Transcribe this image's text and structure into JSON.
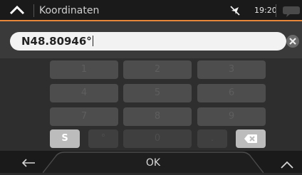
{
  "header": {
    "title": "Koordinaten",
    "time": "19:20"
  },
  "input": {
    "value": "N48.80946°"
  },
  "keypad": {
    "keys": [
      "1",
      "2",
      "3",
      "4",
      "5",
      "6",
      "7",
      "8",
      "9"
    ],
    "s_key": "S",
    "degree_key": "°",
    "zero_key": "0",
    "dot_key": "."
  },
  "footer": {
    "ok_label": "OK"
  },
  "colors": {
    "accent": "#e8873a",
    "background": "#2b2b2b",
    "key": "#4d4d4d",
    "active_key": "#bcbcbc"
  },
  "icons": {
    "back": "chevron-up-icon",
    "gps": "gps-off-icon",
    "message": "speech-bubble-icon",
    "clear": "clear-icon",
    "backspace": "backspace-icon",
    "arrow": "arrow-left-icon"
  }
}
